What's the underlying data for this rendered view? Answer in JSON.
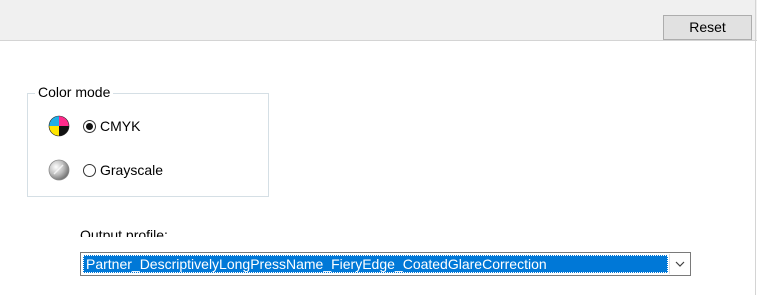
{
  "toolbar": {
    "reset_label": "Reset"
  },
  "color_mode": {
    "legend": "Color mode",
    "options": [
      {
        "label": "CMYK",
        "selected": true,
        "icon": "cmyk-color-wheel-icon"
      },
      {
        "label": "Grayscale",
        "selected": false,
        "icon": "grayscale-sphere-icon"
      }
    ]
  },
  "output_profile": {
    "label": "Output profile:",
    "selected_value": "Partner_DescriptivelyLongPressName_FieryEdge_CoatedGlareCorrection"
  },
  "colors": {
    "selection": "#0078d7",
    "toolbar_bg": "#f0f0f0",
    "group_border": "#d5dfe5"
  }
}
